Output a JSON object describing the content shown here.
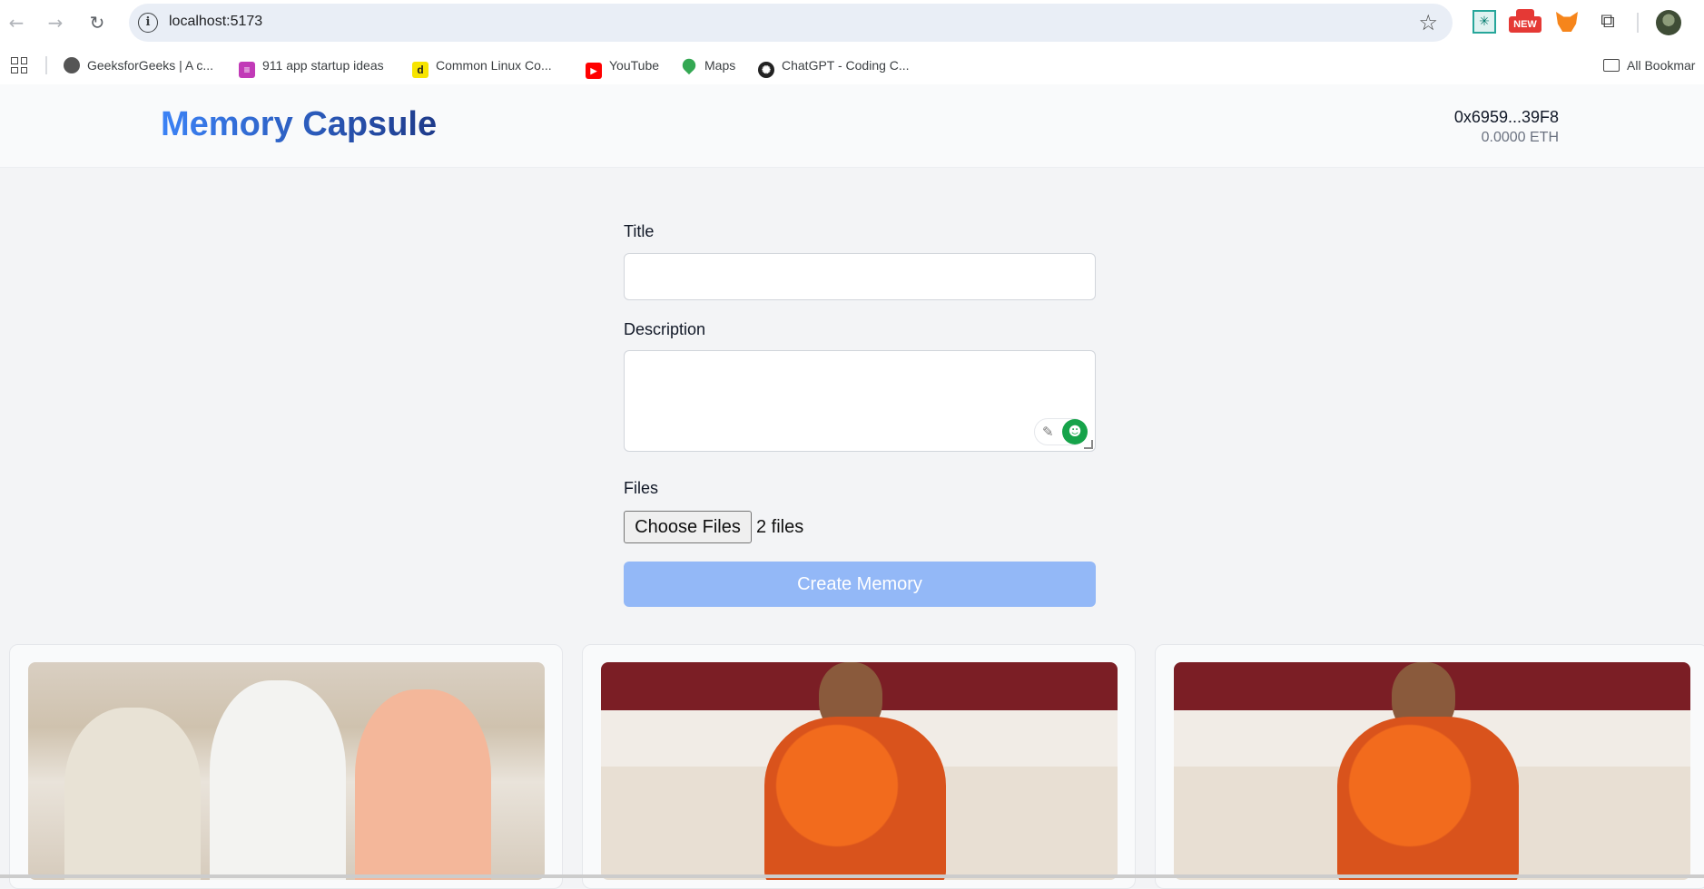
{
  "browser": {
    "url": "localhost:5173",
    "bookmarks": [
      {
        "label": "GeeksforGeeks | A c..."
      },
      {
        "label": "911 app startup ideas"
      },
      {
        "label": "Common Linux Co..."
      },
      {
        "label": "YouTube"
      },
      {
        "label": "Maps"
      },
      {
        "label": "ChatGPT - Coding C..."
      }
    ],
    "all_bookmarks_label": "All Bookmar",
    "extension_badge": "NEW",
    "colors": {
      "toolbar_bg": "#ffffff",
      "omnibox_bg": "#e9eef6"
    }
  },
  "header": {
    "brand": "Memory Capsule",
    "wallet_address": "0x6959...39F8",
    "wallet_balance": "0.0000 ETH"
  },
  "form": {
    "title_label": "Title",
    "title_value": "",
    "description_label": "Description",
    "description_value": "",
    "files_label": "Files",
    "choose_files_label": "Choose Files",
    "files_selected": "2 files",
    "submit_label": "Create Memory"
  },
  "colors": {
    "brand_start": "#3b82f6",
    "brand_end": "#1e3a8a",
    "button_disabled": "#93b8f7",
    "page_bg": "#f3f4f6"
  },
  "memories": [
    {
      "photo": "group-photo"
    },
    {
      "photo": "woman-portrait"
    },
    {
      "photo": "woman-portrait"
    }
  ]
}
